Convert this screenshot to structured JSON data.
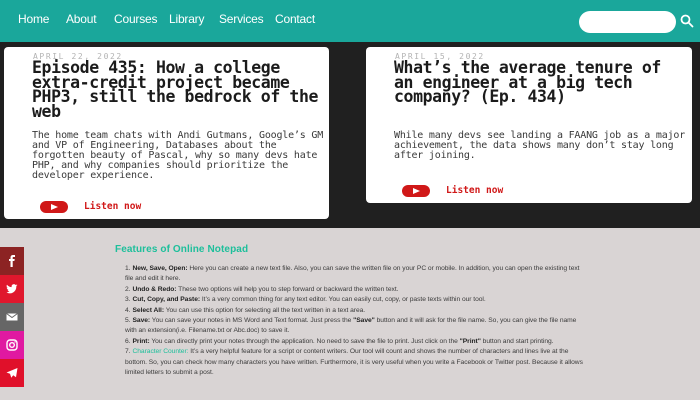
{
  "nav": {
    "items": [
      "Home",
      "About",
      "Courses",
      "Library",
      "Services",
      "Contact"
    ],
    "search_placeholder": ""
  },
  "cards": [
    {
      "date": "APRIL 22, 2022",
      "title": "Episode 435: How a college extra-credit project became PHP3, still the bedrock of the web",
      "description": "The home team chats with Andi Gutmans, Google’s GM and VP of Engineering, Databases about the forgotten beauty of Pascal, why so many devs hate PHP, and why companies should prioritize the developer experience.",
      "listen_label": "Listen now"
    },
    {
      "date": "APRIL 15, 2022",
      "title": "What’s the average tenure of an engineer at a big tech company? (Ep. 434)",
      "description": "While many devs see landing a FAANG job as a major achievement, the data shows many don’t stay long after joining.",
      "listen_label": "Listen now"
    }
  ],
  "social": [
    "facebook-icon",
    "twitter-icon",
    "mail-icon",
    "instagram-icon",
    "telegram-icon"
  ],
  "article": {
    "heading": "Features of Online Notepad",
    "items": [
      {
        "num": "1.",
        "term": "New, Save, Open:",
        "text": " Here you can create a new text file. Also, you can save the written file on your PC or mobile. In addition, you can open the existing text file and edit it here."
      },
      {
        "num": "2.",
        "term": "Undo & Redo:",
        "text": " These two options will help you to step forward or backward the written text."
      },
      {
        "num": "3.",
        "term": "Cut, Copy, and Paste:",
        "text": " It’s a very common thing for any text editor. You can easily cut, copy, or paste texts within our tool."
      },
      {
        "num": "4.",
        "term": "Select All:",
        "text": " You can use this option for selecting all the text written in a text area."
      },
      {
        "num": "5.",
        "term": "Save:",
        "text_a": " You can save your notes in MS Word and Text format. Just press the ",
        "quote": "\"Save\"",
        "text_b": " button and it will ask for the file name. So, you can give the file name with an extension(i.e. Filename.txt or Abc.doc) to save it."
      },
      {
        "num": "6.",
        "term": "Print:",
        "text_a": " You can directly print your notes through the application. No need to save the file to print. Just click on the ",
        "quote": "\"Print\"",
        "text_b": " button and start printing."
      },
      {
        "num": "7.",
        "term": "Character Counter:",
        "text": " It’s a very helpful feature for a script or content writers. Our tool will count and shows the number of characters and lines live at the bottom. So, you can check how many characters you have written. Furthermore, it is very useful when you write a Facebook or Twitter post. Because it allows limited letters to submit a post."
      }
    ]
  }
}
